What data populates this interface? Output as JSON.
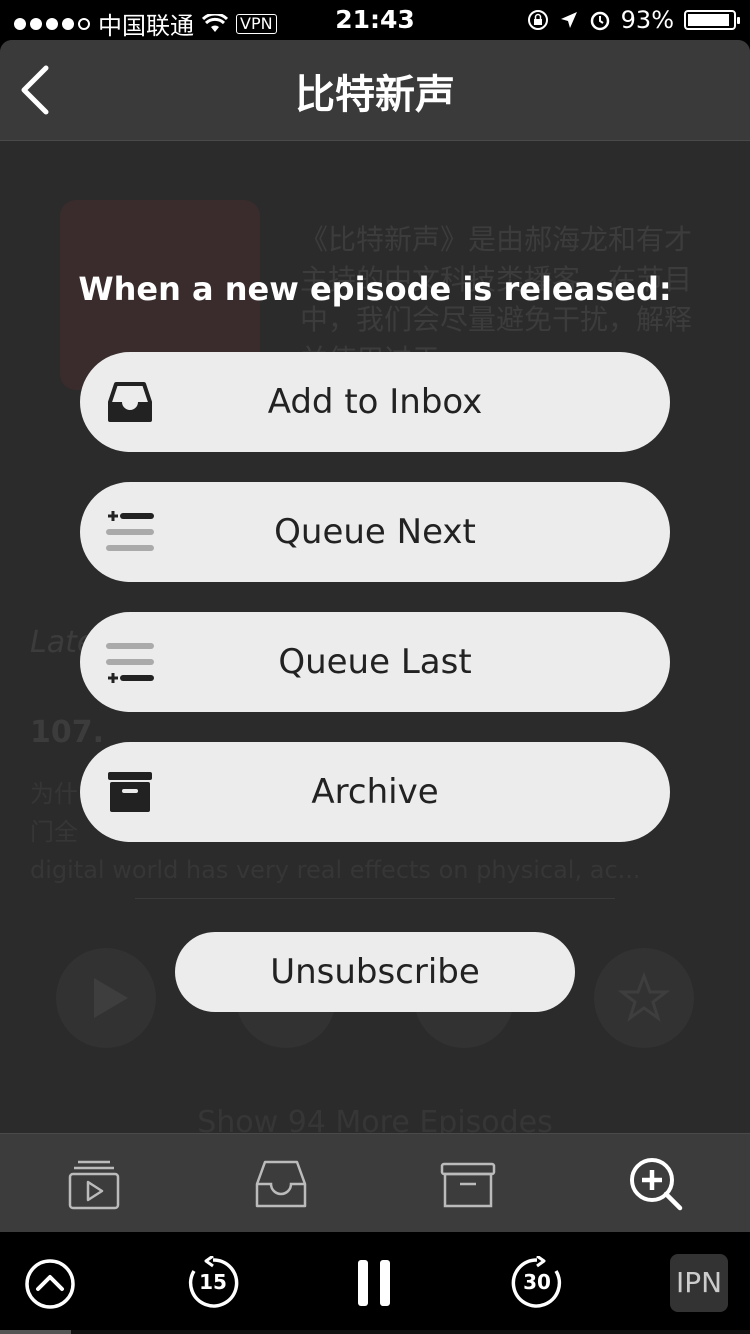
{
  "status_bar": {
    "carrier": "中国联通",
    "vpn": "VPN",
    "time": "21:43",
    "battery": "93%",
    "battery_level": 0.93
  },
  "nav": {
    "title": "比特新声",
    "back_icon": "chevron-left-icon"
  },
  "background": {
    "description": "《比特新声》是由郝海龙和有才主持的中文科技类播客。在节目中，我们会尽量避免干扰，解释并使用过于...",
    "latest_label": "Late",
    "episode_title": "107.",
    "episode_desc_line1": "为什",
    "episode_desc_line2": "门全",
    "episode_desc_line3": "digital world has very real effects on physical, ac...",
    "more_episodes": "Show 94 More Episodes"
  },
  "prompt": {
    "title": "When a new episode is released:",
    "options": [
      {
        "label": "Add to Inbox",
        "icon": "inbox-icon"
      },
      {
        "label": "Queue Next",
        "icon": "queue-next-icon"
      },
      {
        "label": "Queue Last",
        "icon": "queue-last-icon"
      },
      {
        "label": "Archive",
        "icon": "archive-icon"
      }
    ],
    "unsubscribe": "Unsubscribe"
  },
  "tab_bar": {
    "tabs": [
      "play-queue-icon",
      "inbox-icon",
      "archive-icon",
      "search-add-icon"
    ]
  },
  "player": {
    "skip_back": "15",
    "skip_forward": "30",
    "podcast_badge": "IPN",
    "progress": 0.095
  }
}
